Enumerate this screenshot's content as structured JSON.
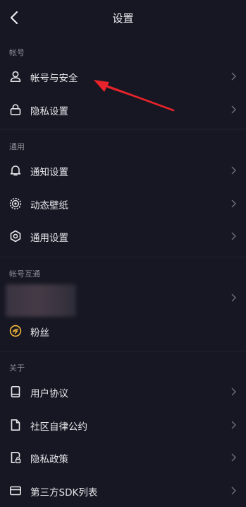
{
  "header": {
    "title": "设置"
  },
  "sections": {
    "account": "帐号",
    "general": "通用",
    "interop": "帐号互通",
    "about": "关于"
  },
  "rows": {
    "account_security": "帐号与安全",
    "privacy_settings": "隐私设置",
    "notification_settings": "通知设置",
    "live_wallpaper": "动态壁纸",
    "general_settings": "通用设置",
    "fans": "粉丝",
    "user_agreement": "用户协议",
    "community_rules": "社区自律公约",
    "privacy_policy": "隐私政策",
    "third_party_sdk": "第三方SDK列表"
  },
  "icons": {
    "back": "chevron-left-icon",
    "account_security": "user-icon",
    "privacy_settings": "lock-icon",
    "notification_settings": "bell-icon",
    "live_wallpaper": "wallpaper-icon",
    "general_settings": "gear-icon",
    "fans": "fans-icon",
    "user_agreement": "book-icon",
    "community_rules": "document-icon",
    "privacy_policy": "privacy-doc-icon",
    "third_party_sdk": "card-icon"
  },
  "colors": {
    "background": "#161722",
    "text": "#e6e6ea",
    "section_label": "#8b8c96",
    "chevron": "#6e6f79",
    "fans_accent": "#f5b83d",
    "annotation_arrow": "#e8232b"
  }
}
